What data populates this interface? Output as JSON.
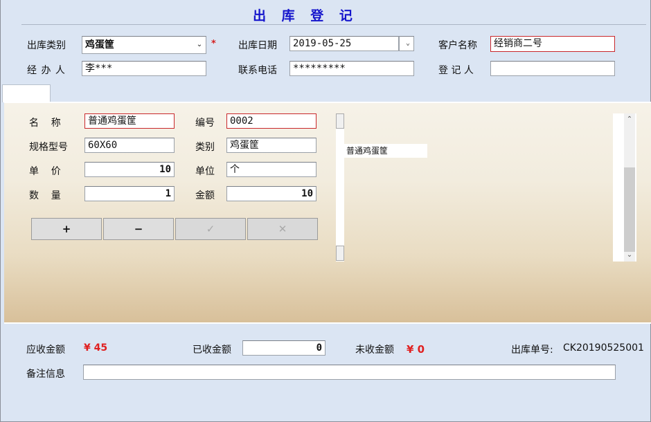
{
  "title": "出 库 登 记",
  "header": {
    "category_label": "出库类别",
    "category_value": "鸡蛋筐",
    "required_star": "*",
    "date_label": "出库日期",
    "date_value": "2019-05-25",
    "customer_label": "客户名称",
    "customer_value": "经销商二号",
    "handler_label": "经 办 人",
    "handler_value": "李***",
    "phone_label": "联系电话",
    "phone_value": "*********",
    "recorder_label": "登 记 人",
    "recorder_value": ""
  },
  "item": {
    "name_label": "名    称",
    "name_value": "普通鸡蛋筐",
    "code_label": "编号",
    "code_value": "0002",
    "spec_label": "规格型号",
    "spec_value": "60X60",
    "type_label": "类别",
    "type_value": "鸡蛋筐",
    "price_label": "单    价",
    "price_value": "10",
    "unit_label": "单位",
    "unit_value": "个",
    "qty_label": "数    量",
    "qty_value": "1",
    "amount_label": "金额",
    "amount_value": "10"
  },
  "buttons": {
    "add": "+",
    "remove": "−",
    "confirm": "✓",
    "cancel": "✕"
  },
  "list": {
    "items": [
      "普通鸡蛋筐"
    ]
  },
  "footer": {
    "receivable_label": "应收金额",
    "receivable_value": "¥ 45",
    "received_label": "已收金额",
    "received_value": "0",
    "unreceived_label": "未收金额",
    "unreceived_value": "¥ 0",
    "order_no_label": "出库单号:",
    "order_no_value": "CK20190525001",
    "remark_label": "备注信息",
    "remark_value": ""
  },
  "colors": {
    "title": "#1414cc",
    "accent_red": "#e02020",
    "background": "#dbe5f3"
  }
}
